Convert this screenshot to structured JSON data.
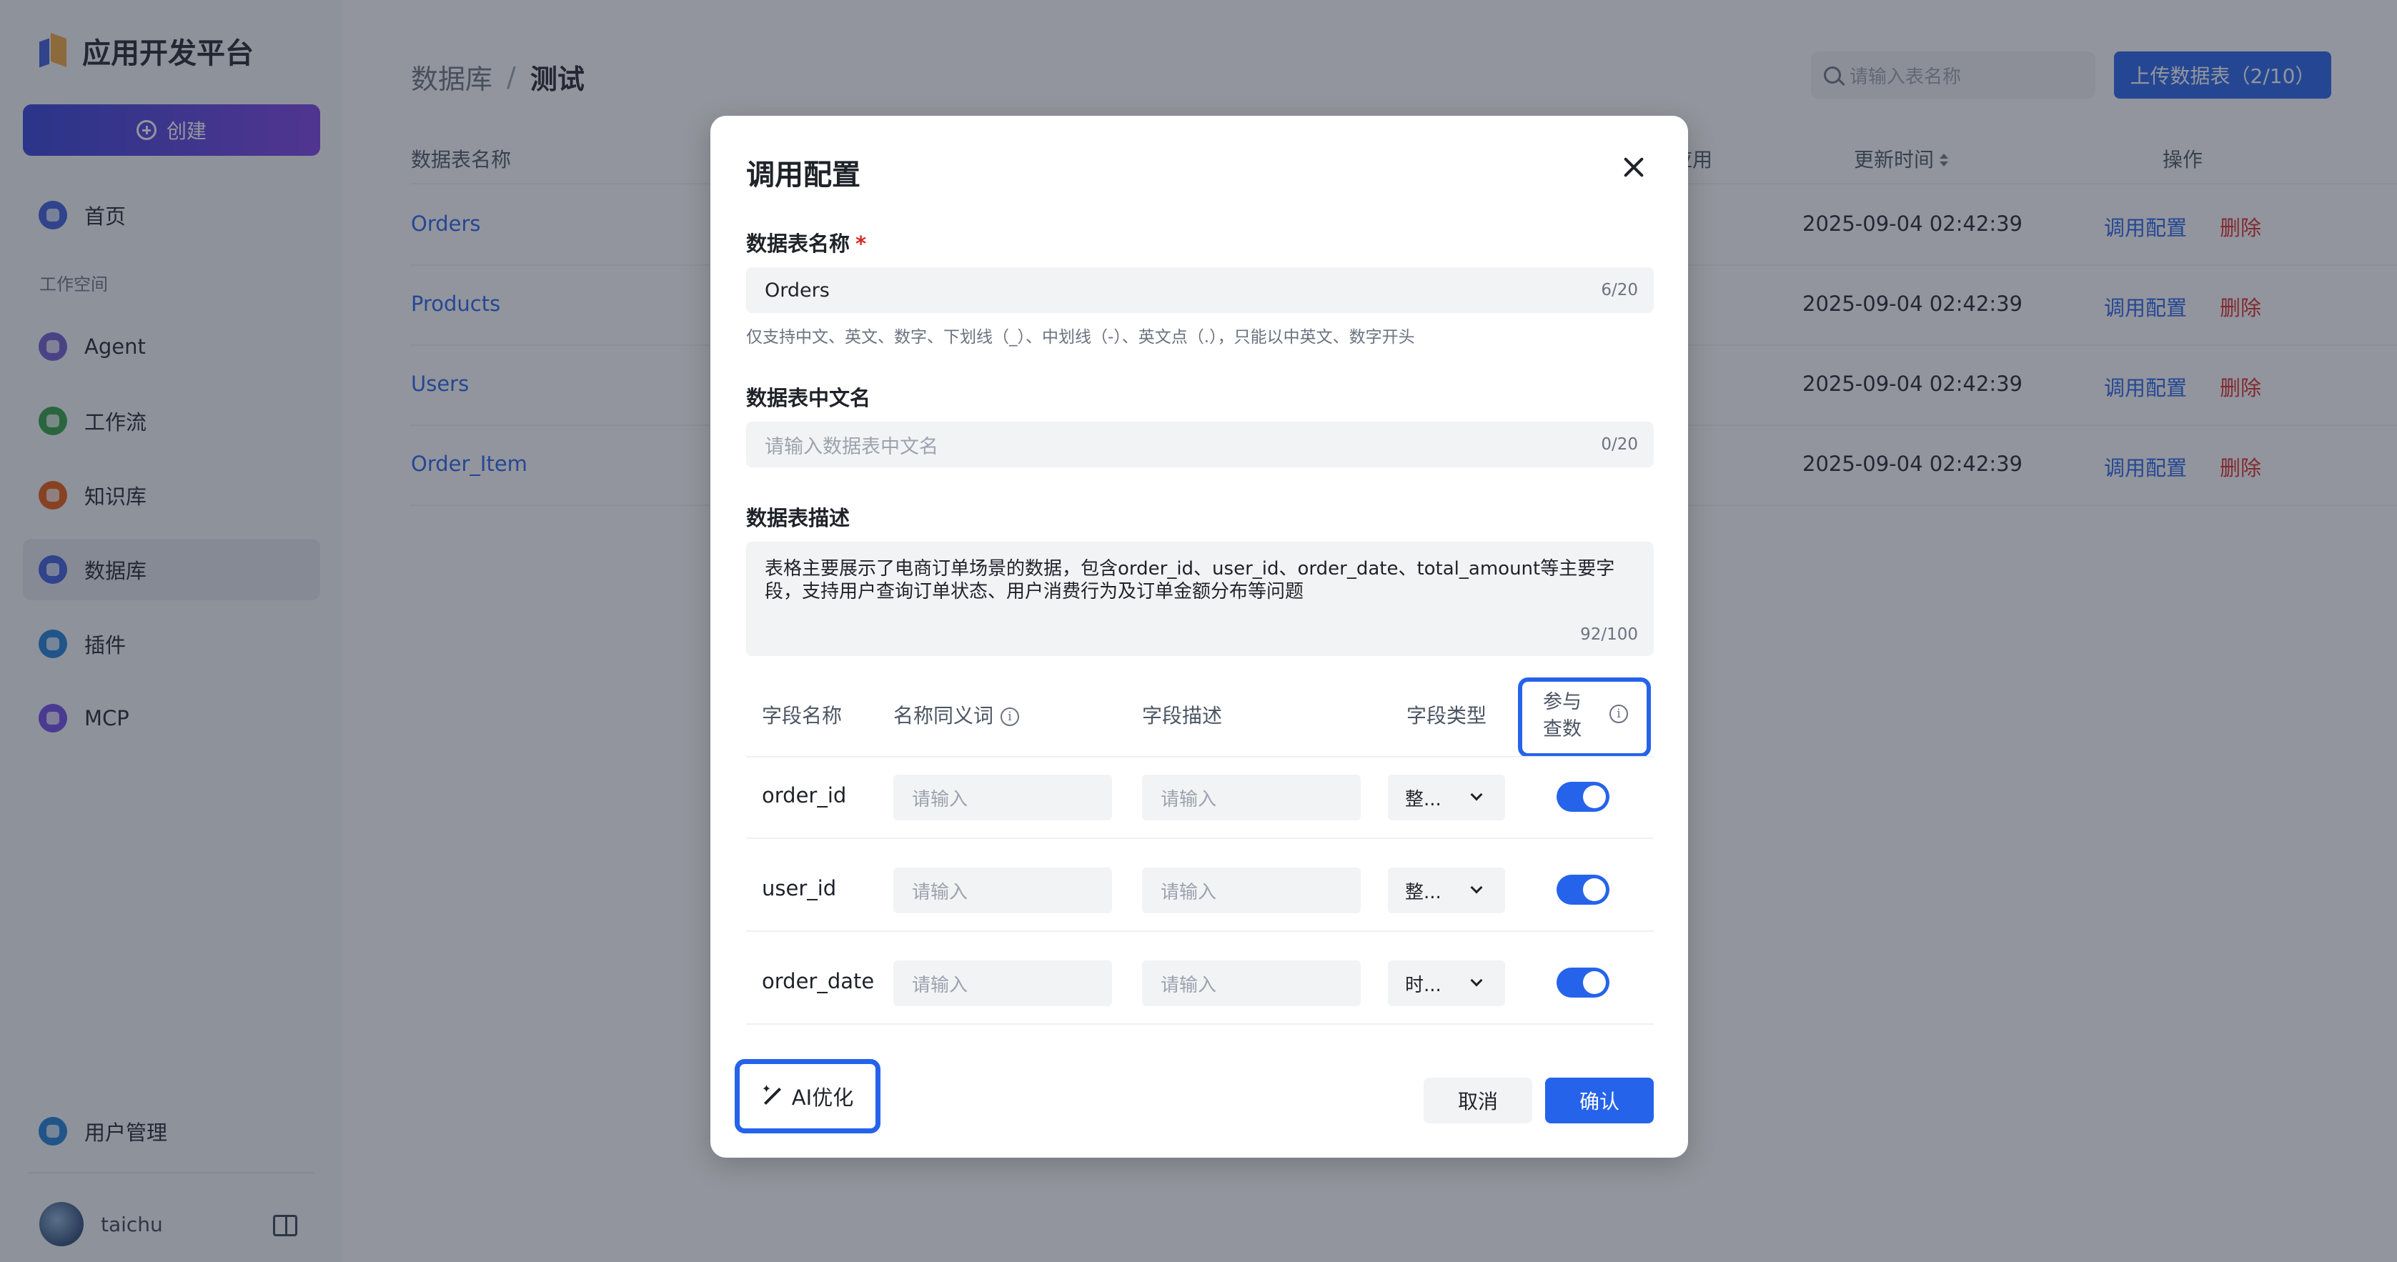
{
  "sidebar": {
    "brand": "应用开发平台",
    "create_label": "创建",
    "items": [
      {
        "label": "首页",
        "icon": "home-icon",
        "color": "#3b5bdb"
      },
      {
        "label": "Agent",
        "icon": "agent-icon",
        "color": "#6d5bd0"
      },
      {
        "label": "工作流",
        "icon": "workflow-icon",
        "color": "#2f9e44"
      },
      {
        "label": "知识库",
        "icon": "knowledge-icon",
        "color": "#e8590c"
      },
      {
        "label": "数据库",
        "icon": "database-icon",
        "color": "#3b5bdb"
      },
      {
        "label": "插件",
        "icon": "plugin-icon",
        "color": "#1c7ed6"
      },
      {
        "label": "MCP",
        "icon": "mcp-icon",
        "color": "#7048e8"
      }
    ],
    "workspace_label": "工作空间",
    "user_mgmt": "用户管理",
    "username": "taichu"
  },
  "page": {
    "breadcrumb_parent": "数据库",
    "breadcrumb_sep": "/",
    "breadcrumb_current": "测试",
    "search_placeholder": "请输入表名称",
    "upload_label": "上传数据表（2/10）"
  },
  "table": {
    "headers": {
      "name": "数据表名称",
      "apply": "应用",
      "updated": "更新时间",
      "actions": "操作"
    },
    "rows": [
      {
        "name": "Orders",
        "updated": "2025-09-04 02:42:39",
        "config": "调用配置",
        "delete": "删除"
      },
      {
        "name": "Products",
        "updated": "2025-09-04 02:42:39",
        "config": "调用配置",
        "delete": "删除"
      },
      {
        "name": "Users",
        "updated": "2025-09-04 02:42:39",
        "config": "调用配置",
        "delete": "删除"
      },
      {
        "name": "Order_Item",
        "updated": "2025-09-04 02:42:39",
        "config": "调用配置",
        "delete": "删除"
      }
    ]
  },
  "modal": {
    "title": "调用配置",
    "name_label": "数据表名称",
    "required_mark": "*",
    "name_value": "Orders",
    "name_counter": "6/20",
    "name_hint": "仅支持中文、英文、数字、下划线（_）、中划线（-）、英文点（.），只能以中英文、数字开头",
    "cn_label": "数据表中文名",
    "cn_placeholder": "请输入数据表中文名",
    "cn_counter": "0/20",
    "desc_label": "数据表描述",
    "desc_value": "表格主要展示了电商订单场景的数据，包含order_id、user_id、order_date、total_amount等主要字段，支持用户查询订单状态、用户消费行为及订单金额分布等问题",
    "desc_counter": "92/100",
    "field_headers": {
      "name": "字段名称",
      "synonym": "名称同义词",
      "desc": "字段描述",
      "type": "字段类型",
      "query": "参与查数"
    },
    "fields": [
      {
        "name": "order_id",
        "synonym_ph": "请输入",
        "desc_ph": "请输入",
        "type": "整...",
        "enabled": "on"
      },
      {
        "name": "user_id",
        "synonym_ph": "请输入",
        "desc_ph": "请输入",
        "type": "整...",
        "enabled": "on"
      },
      {
        "name": "order_date",
        "synonym_ph": "请输入",
        "desc_ph": "请输入",
        "type": "时...",
        "enabled": "on"
      }
    ],
    "ai_label": "AI优化",
    "cancel_label": "取消",
    "ok_label": "确认"
  },
  "colors": {
    "accent": "#2563eb",
    "danger": "#dc2626",
    "highlight_border": "#2563eb"
  }
}
